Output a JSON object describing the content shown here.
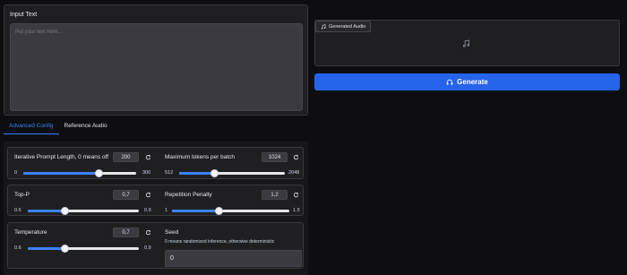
{
  "input": {
    "label": "Input Text",
    "placeholder": "Put your text here..."
  },
  "audio": {
    "label": "Generated Audio",
    "label_icon": "music-note-icon",
    "center_icon": "music-note-icon"
  },
  "generate": {
    "label": "Generate",
    "icon": "headphones-icon",
    "color": "#2563eb"
  },
  "tabs": [
    {
      "label": "Advanced Config",
      "active": true
    },
    {
      "label": "Reference Audio",
      "active": false
    }
  ],
  "controls": {
    "iterative_prompt_length": {
      "label": "Iterative Prompt Length, 0 means off",
      "value": "200",
      "min": "0",
      "max": "300",
      "fraction": 0.667
    },
    "max_tokens": {
      "label": "Maximum tokens per batch",
      "value": "1024",
      "min": "512",
      "max": "2048",
      "fraction": 0.333
    },
    "top_p": {
      "label": "Top-P",
      "value": "0,7",
      "min": "0.6",
      "max": "0.9",
      "fraction": 0.333
    },
    "repetition_penalty": {
      "label": "Repetition Penalty",
      "value": "1,2",
      "min": "1",
      "max": "1.5",
      "fraction": 0.4
    },
    "temperature": {
      "label": "Temperature",
      "value": "0,7",
      "min": "0.6",
      "max": "0.9",
      "fraction": 0.333
    },
    "seed": {
      "label": "Seed",
      "description": "0 means randomized inference, otherwise deterministic",
      "value": "0"
    }
  },
  "colors": {
    "accent": "#3b82f6",
    "background": "#0e0e10",
    "panel": "#1f1f22"
  }
}
